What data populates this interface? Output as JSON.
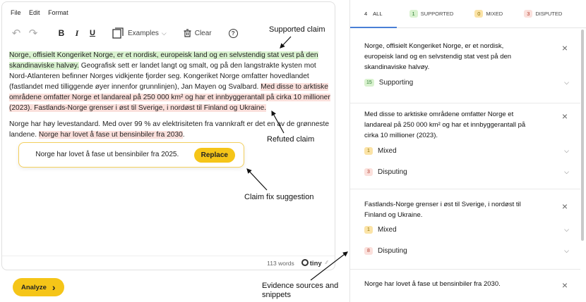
{
  "menu": {
    "file": "File",
    "edit": "Edit",
    "format": "Format"
  },
  "toolbar": {
    "undo": "↶",
    "redo": "↷",
    "bold": "B",
    "italic": "I",
    "underline": "U",
    "examples": "Examples",
    "examples_caret": "⌵",
    "clear": "Clear",
    "help": "?"
  },
  "editor": {
    "p1_sup": "Norge, offisielt Kongeriket Norge, er et nordisk, europeisk land og en selvstendig stat vest på den skandinaviske halvøy.",
    "p1_plain": " Geografisk sett er landet langt og smalt, og på den langstrakte kysten mot Nord-Atlanteren befinner Norges vidkjente fjorder seg. Kongeriket Norge omfatter hovedlandet (fastlandet med tilliggende øyer innenfor grunnlinjen), Jan Mayen og Svalbard. ",
    "p1_ref": "Med disse to arktiske områdene omfatter Norge et landareal på 250 000 km² og har et innbyggerantall på cirka 10 millioner (2023). Fastlands-Norge grenser i øst til Sverige, i nordøst til Finland og Ukraine.",
    "p2_plain": "Norge har høy levestandard. Med over 99 % av elektrisiteten fra vannkraft er det en av de grønneste landene. ",
    "p2_ref": "Norge har lovet å fase ut bensinbiler fra 2030",
    "p2_end": "."
  },
  "popup": {
    "text": "Norge har lovet å fase ut bensinbiler fra 2025.",
    "button": "Replace"
  },
  "status": {
    "words": "113 words",
    "logo": "tiny",
    "resize": "⁄⁄"
  },
  "analyze": {
    "label": "Analyze",
    "arrow": "›"
  },
  "annotations": {
    "supported": "Supported claim",
    "refuted": "Refuted claim",
    "fix": "Claim fix suggestion",
    "evidence": "Evidence sources and snippets"
  },
  "tabs": [
    {
      "num": "4",
      "label": "ALL",
      "bg": "#ffffff",
      "fg": "#222222"
    },
    {
      "num": "1",
      "label": "SUPPORTED",
      "bg": "#d9f2cf",
      "fg": "#2e7d32"
    },
    {
      "num": "0",
      "label": "MIXED",
      "bg": "#fbe3a6",
      "fg": "#8a6d00"
    },
    {
      "num": "3",
      "label": "DISPUTED",
      "bg": "#fbe0dc",
      "fg": "#b23b2b"
    }
  ],
  "claims": [
    {
      "text": "Norge, offisielt Kongeriket Norge, er et nordisk, europeisk land og en selvstendig stat vest på den skandinaviske halvøy.",
      "evidence": [
        {
          "num": "15",
          "label": "Supporting",
          "bg": "#d9f2cf",
          "fg": "#2e7d32"
        }
      ]
    },
    {
      "text": "Med disse to arktiske områdene omfatter Norge et landareal på 250 000 km² og har et innbyggerantall på cirka 10 millioner (2023).",
      "evidence": [
        {
          "num": "1",
          "label": "Mixed",
          "bg": "#fbe3a6",
          "fg": "#8a6d00"
        },
        {
          "num": "3",
          "label": "Disputing",
          "bg": "#fbe0dc",
          "fg": "#b23b2b"
        }
      ]
    },
    {
      "text": "Fastlands-Norge grenser i øst til Sverige, i nordøst til Finland og Ukraine.",
      "evidence": [
        {
          "num": "1",
          "label": "Mixed",
          "bg": "#fbe3a6",
          "fg": "#8a6d00"
        },
        {
          "num": "8",
          "label": "Disputing",
          "bg": "#fbe0dc",
          "fg": "#b23b2b"
        }
      ]
    },
    {
      "text": "Norge har lovet å fase ut bensinbiler fra 2030.",
      "evidence": []
    }
  ],
  "close_glyph": "×",
  "chevron_glyph": "⌵"
}
